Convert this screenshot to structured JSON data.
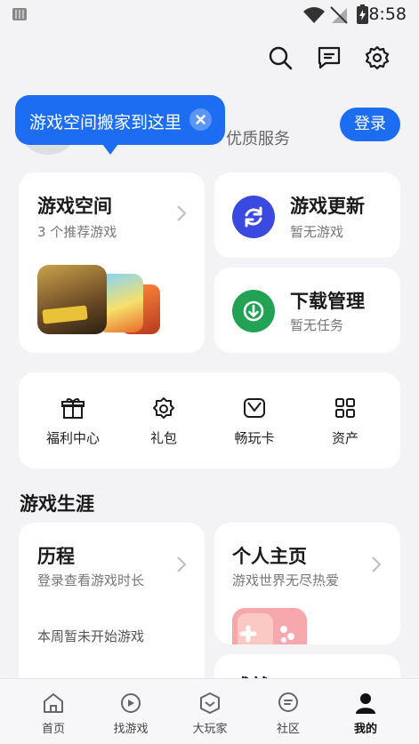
{
  "status_bar": {
    "time": "8:58"
  },
  "profile": {
    "subtitle": "优质服务",
    "login_label": "登录",
    "tooltip_text": "游戏空间搬家到这里"
  },
  "game_space": {
    "title": "游戏空间",
    "subtitle": "3 个推荐游戏"
  },
  "game_update": {
    "title": "游戏更新",
    "subtitle": "暂无游戏"
  },
  "download_manager": {
    "title": "下载管理",
    "subtitle": "暂无任务"
  },
  "tools": [
    {
      "label": "福利中心",
      "icon": "gift-icon"
    },
    {
      "label": "礼包",
      "icon": "gift-pack-icon"
    },
    {
      "label": "畅玩卡",
      "icon": "play-card-icon"
    },
    {
      "label": "资产",
      "icon": "grid-icon"
    }
  ],
  "career": {
    "section_title": "游戏生涯",
    "history": {
      "title": "历程",
      "subtitle": "登录查看游戏时长",
      "note": "本周暂未开始游戏"
    },
    "homepage": {
      "title": "个人主页",
      "subtitle": "游戏世界无尽热爱"
    },
    "partial_card_title": "成就"
  },
  "bottom_nav": [
    {
      "label": "首页",
      "icon": "home-icon"
    },
    {
      "label": "找游戏",
      "icon": "find-game-icon"
    },
    {
      "label": "大玩家",
      "icon": "player-icon"
    },
    {
      "label": "社区",
      "icon": "community-icon"
    },
    {
      "label": "我的",
      "icon": "me-icon",
      "active": true
    }
  ],
  "colors": {
    "accent": "#1d6df2",
    "update_icon": "#3a49e0",
    "download_icon": "#23a256"
  }
}
